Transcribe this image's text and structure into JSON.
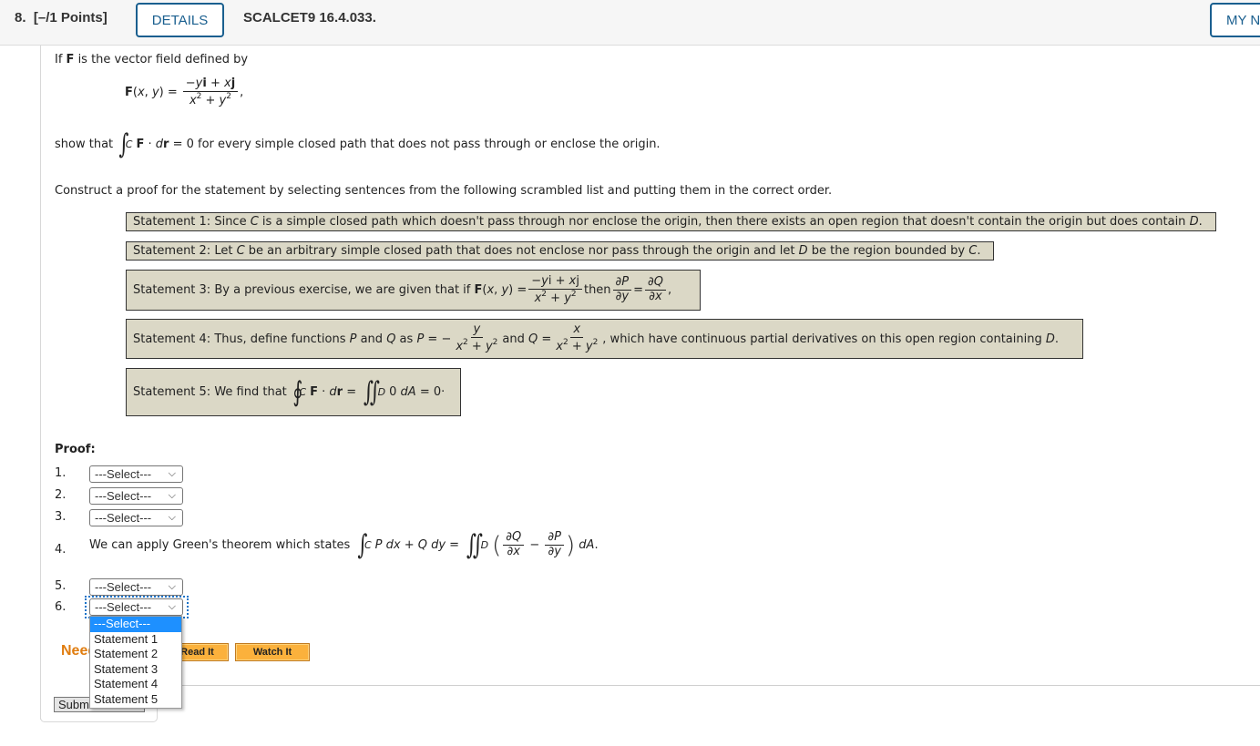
{
  "header": {
    "question_number": "8.",
    "points": "[–/1 Points]",
    "details_button": "DETAILS",
    "question_code": "SCALCET9 16.4.033.",
    "my_notes_button": "MY NOTES"
  },
  "problem": {
    "intro": "If F is the vector field defined by",
    "field_lhs": "F(x, y) =",
    "field_numerator": "−yi + xj",
    "field_denominator": "x² + y²",
    "show_that_prefix": "show that",
    "integral_expr": "F · dr = 0",
    "show_that_suffix": "for every simple closed path that does not pass through or enclose the origin.",
    "instructions": "Construct a proof for the statement by selecting sentences from the following scrambled list and putting them in the correct order."
  },
  "statements": [
    {
      "label": "Statement 1:",
      "text": "Since C is a simple closed path which doesn't pass through nor enclose the origin, then there exists an open region that doesn't contain the origin but does contain D."
    },
    {
      "label": "Statement 2:",
      "text": "Let C be an arbitrary simple closed path that does not enclose nor pass through the origin and let D be the region bounded by C."
    },
    {
      "label": "Statement 3:",
      "text": "By a previous exercise, we are given that if F(x, y) = (−yi + xj)/(x² + y²) then ∂P/∂y = ∂Q/∂x,"
    },
    {
      "label": "Statement 4:",
      "text": "Thus, define functions P and Q as P = −y/(x² + y²) and Q = x/(x² + y²), which have continuous partial derivatives on this open region containing D."
    },
    {
      "label": "Statement 5:",
      "text": "We find that ∮C F · dr = ∬D 0 dA = 0·"
    }
  ],
  "proof": {
    "label": "Proof:",
    "rows": [
      {
        "number": "1.",
        "type": "select",
        "value": "---Select---"
      },
      {
        "number": "2.",
        "type": "select",
        "value": "---Select---"
      },
      {
        "number": "3.",
        "type": "select",
        "value": "---Select---"
      },
      {
        "number": "4.",
        "type": "text",
        "value": "We can apply Green's theorem which states ∫C P dx + Q dy = ∬D (∂Q/∂x − ∂P/∂y) dA."
      },
      {
        "number": "5.",
        "type": "select",
        "value": "---Select---"
      },
      {
        "number": "6.",
        "type": "select",
        "value": "---Select---"
      }
    ],
    "dropdown_options": [
      "---Select---",
      "Statement 1",
      "Statement 2",
      "Statement 3",
      "Statement 4",
      "Statement 5"
    ],
    "dropdown_highlighted": "---Select---"
  },
  "help": {
    "need_help_label": "Need Help?",
    "read_it": "Read It",
    "watch_it": "Watch It"
  },
  "submit_button": "Submit Answer",
  "colors": {
    "accent_blue": "#1a5f8f",
    "statement_bg": "#dbd8c6",
    "help_orange": "#e07d10",
    "button_orange": "#fbb13c",
    "selection_blue": "#1e90ff"
  }
}
